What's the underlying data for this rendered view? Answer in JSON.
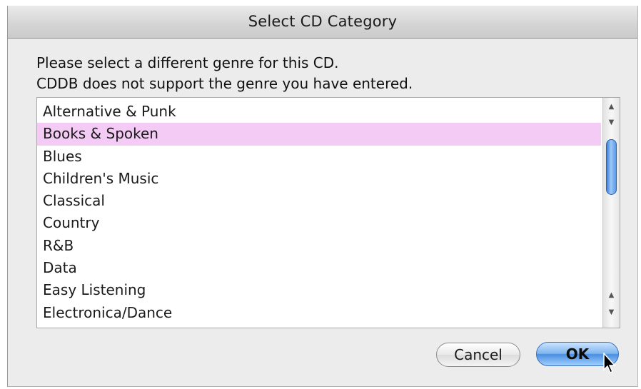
{
  "dialog": {
    "title": "Select CD Category",
    "message_line1": "Please select a different genre for this CD.",
    "message_line2": "CDDB does not support the genre you have entered."
  },
  "genres": [
    "Alternative & Punk",
    "Books & Spoken",
    "Blues",
    "Children's Music",
    "Classical",
    "Country",
    "R&B",
    "Data",
    "Easy Listening",
    "Electronica/Dance"
  ],
  "selected_genre": "Books & Spoken",
  "buttons": {
    "cancel": "Cancel",
    "ok": "OK"
  },
  "icons": {
    "scroll_up": "scroll-up-arrow-icon",
    "scroll_down": "scroll-down-arrow-icon",
    "cursor": "mouse-pointer-icon"
  },
  "colors": {
    "selection": "#f3cbf5",
    "default_button": "#6aa6ea"
  }
}
